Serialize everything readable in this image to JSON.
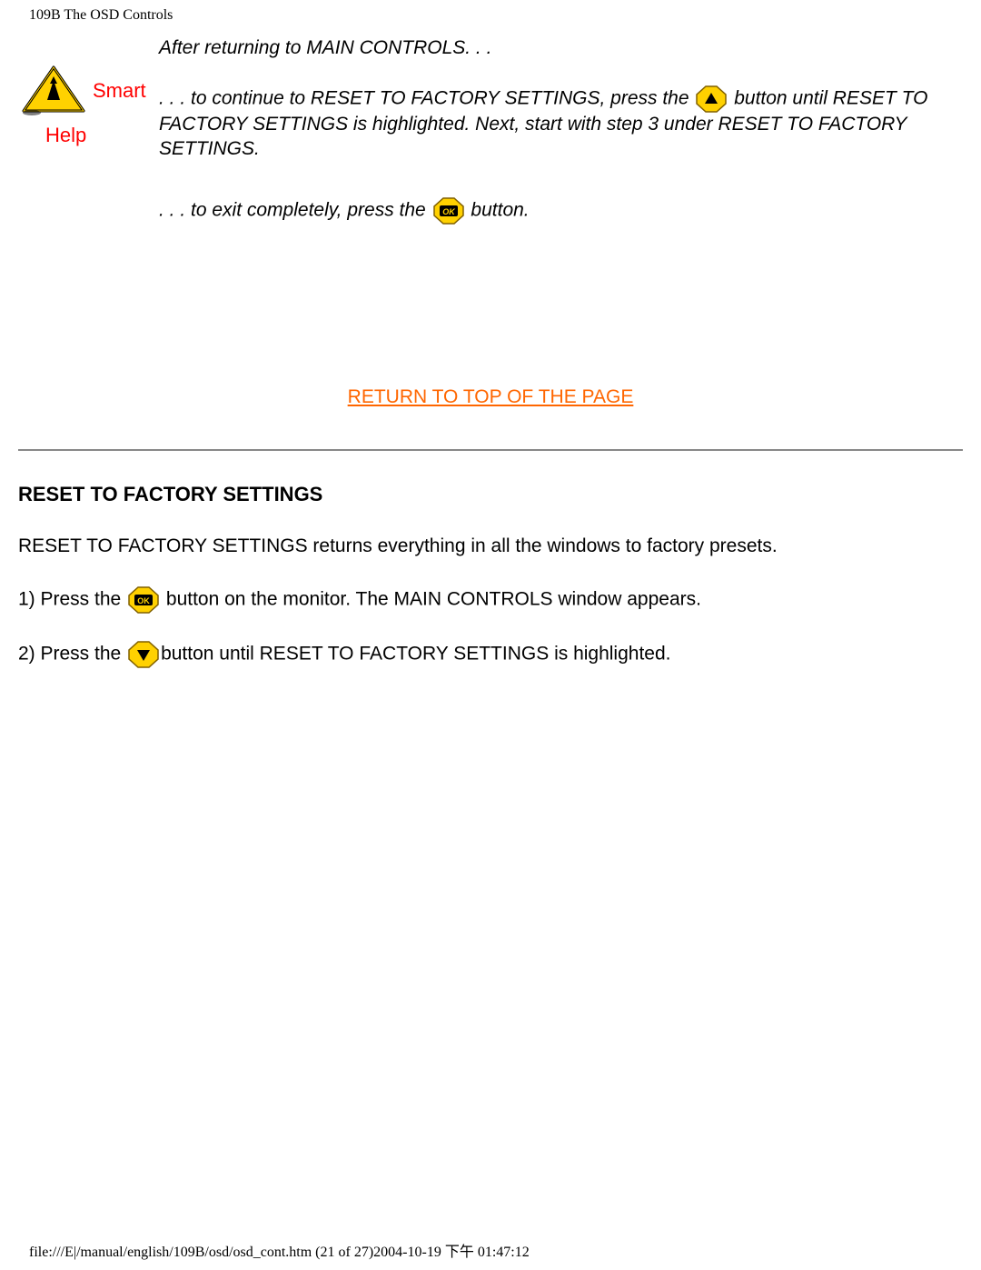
{
  "header": "109B The OSD Controls",
  "smart_help": {
    "smart": "Smart",
    "help": "Help"
  },
  "body": {
    "p1": "After returning to MAIN CONTROLS. . .",
    "p2a": ". . . to continue to RESET TO FACTORY SETTINGS, press the ",
    "p2b": " button until RESET TO FACTORY SETTINGS is highlighted. Next, start with step 3 under RESET TO FACTORY SETTINGS.",
    "p3a": ". . . to exit completely, press the",
    "p3b": " button."
  },
  "return_link": "RETURN TO TOP OF THE PAGE",
  "section": {
    "heading": "RESET TO FACTORY SETTINGS",
    "p1": "RESET TO FACTORY SETTINGS returns everything in all the windows to factory presets.",
    "step1a": "1) Press the ",
    "step1b": " button on the monitor. The MAIN CONTROLS window appears.",
    "step2a": "2) Press the ",
    "step2b": "button until RESET TO FACTORY SETTINGS is highlighted."
  },
  "footer": "file:///E|/manual/english/109B/osd/osd_cont.htm (21 of 27)2004-10-19 下午 01:47:12"
}
